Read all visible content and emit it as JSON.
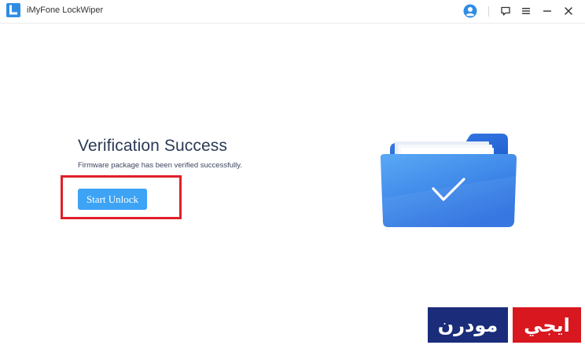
{
  "window": {
    "title": "iMyFone LockWiper",
    "icons": {
      "logo": "lockwiper-logo-icon",
      "account": "account-icon",
      "feedback": "feedback-icon",
      "menu": "menu-icon",
      "minimize": "minimize-icon",
      "close": "close-icon"
    },
    "accent_color": "#3da3f5"
  },
  "main": {
    "title": "Verification Success",
    "subtitle": "Firmware package has been verified successfully.",
    "start_button_label": "Start Unlock",
    "illustration": "folder-check-icon"
  },
  "annotation": {
    "highlight_color": "#e0202a"
  },
  "watermark": {
    "left_text": "مودرن",
    "right_text": "ايجي"
  }
}
